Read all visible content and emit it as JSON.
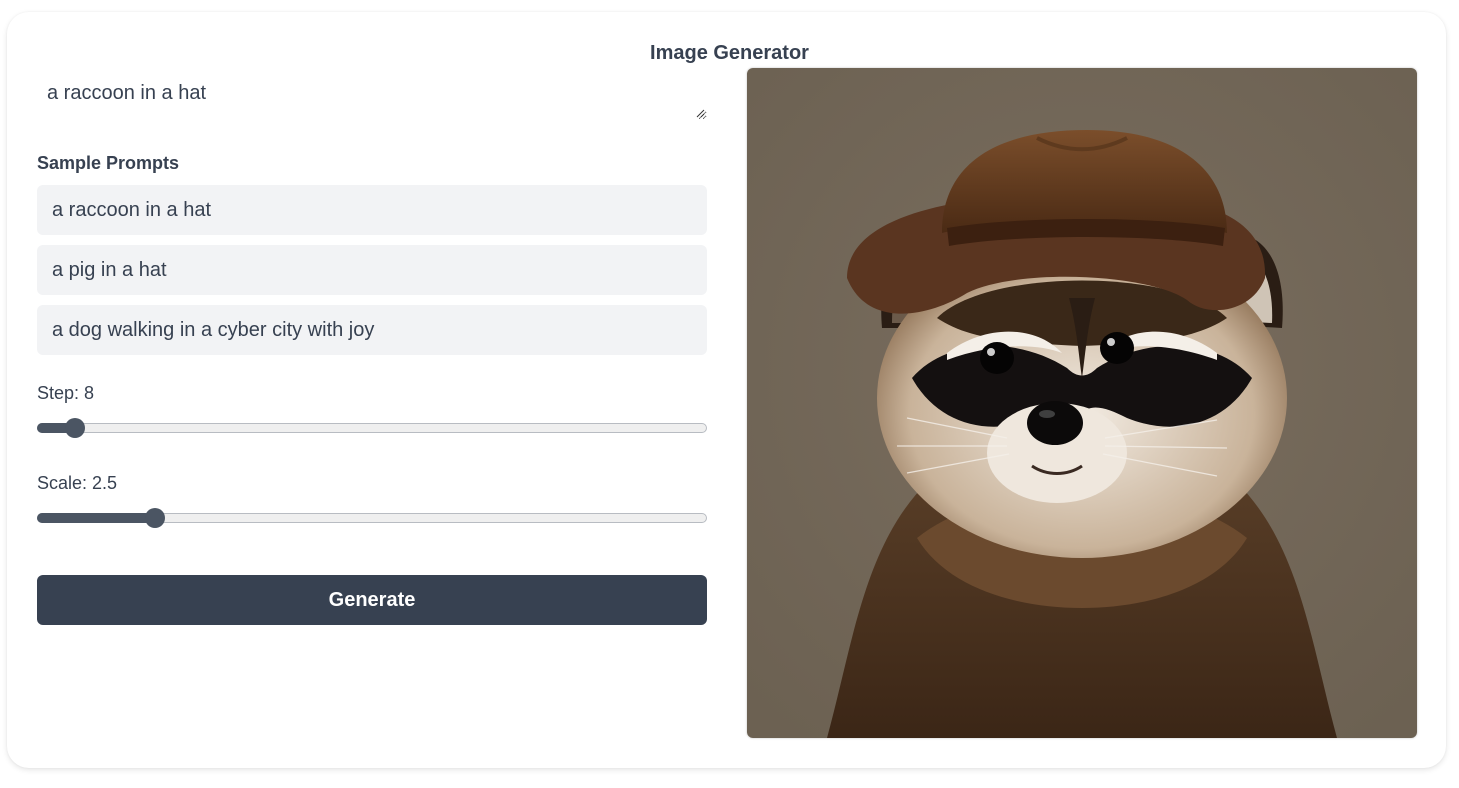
{
  "app": {
    "title": "Image Generator"
  },
  "prompt": {
    "value": "a raccoon in a hat"
  },
  "samples": {
    "heading": "Sample Prompts",
    "items": [
      {
        "label": "a raccoon in a hat"
      },
      {
        "label": "a pig in a hat"
      },
      {
        "label": "a dog walking in a cyber city with joy"
      }
    ]
  },
  "step": {
    "label": "Step: 8",
    "value": 8,
    "position": 0.055
  },
  "scale": {
    "label": "Scale: 2.5",
    "value": 2.5,
    "position": 0.175
  },
  "generate": {
    "label": "Generate"
  },
  "output": {
    "subject": "raccoon-in-hat",
    "background": "#756a5b"
  },
  "colors": {
    "primary": "#374151",
    "sample_bg": "#f2f3f5",
    "slider": "#4b5563"
  }
}
